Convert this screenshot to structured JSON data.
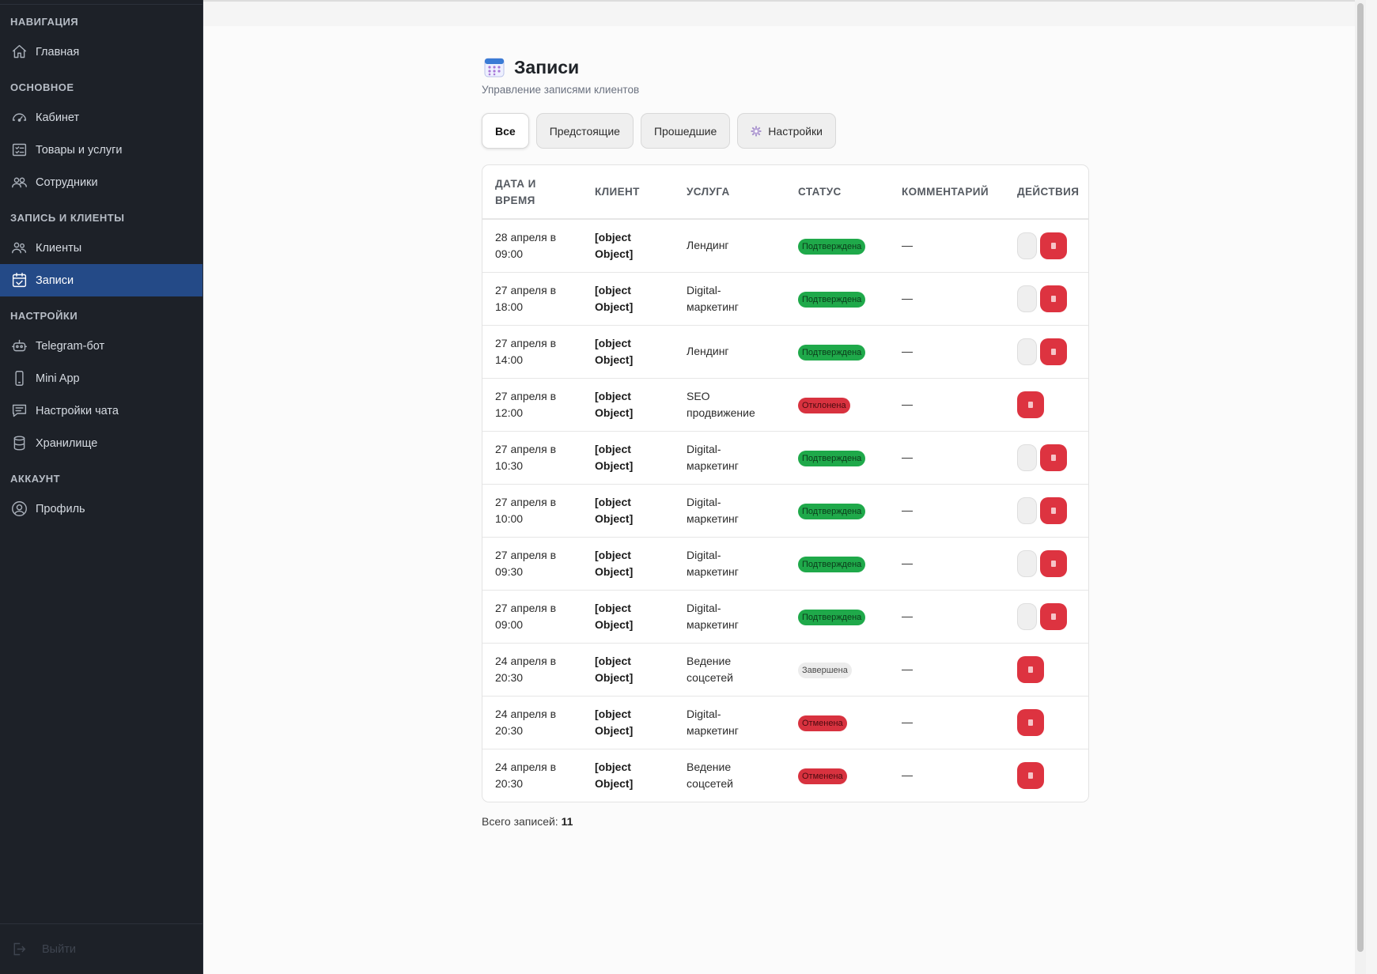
{
  "sidebar": {
    "sections": [
      {
        "title": "НАВИГАЦИЯ",
        "items": [
          {
            "label": "Главная",
            "icon": "home-icon"
          }
        ]
      },
      {
        "title": "ОСНОВНОЕ",
        "items": [
          {
            "label": "Кабинет",
            "icon": "dashboard-icon"
          },
          {
            "label": "Товары и услуги",
            "icon": "list-icon"
          },
          {
            "label": "Сотрудники",
            "icon": "employees-icon"
          }
        ]
      },
      {
        "title": "ЗАПИСЬ И КЛИЕНТЫ",
        "items": [
          {
            "label": "Клиенты",
            "icon": "clients-icon"
          },
          {
            "label": "Записи",
            "icon": "calendar-check-icon",
            "active": true
          }
        ]
      },
      {
        "title": "НАСТРОЙКИ",
        "items": [
          {
            "label": "Telegram-бот",
            "icon": "robot-icon"
          },
          {
            "label": "Mini App",
            "icon": "phone-icon"
          },
          {
            "label": "Настройки чата",
            "icon": "chat-icon"
          },
          {
            "label": "Хранилище",
            "icon": "database-icon"
          }
        ]
      },
      {
        "title": "АККАУНТ",
        "items": [
          {
            "label": "Профиль",
            "icon": "profile-icon"
          }
        ]
      }
    ],
    "logout_label": "Выйти"
  },
  "page": {
    "title": "Записи",
    "subtitle": "Управление записями клиентов"
  },
  "tabs": [
    {
      "label": "Все",
      "active": true
    },
    {
      "label": "Предстоящие"
    },
    {
      "label": "Прошедшие"
    },
    {
      "label": "Настройки",
      "icon": "gear-icon"
    }
  ],
  "table": {
    "headers": {
      "datetime": "ДАТА И ВРЕМЯ",
      "client": "КЛИЕНТ",
      "service": "УСЛУГА",
      "status": "СТАТУС",
      "comment": "КОММЕНТАРИЙ",
      "actions": "ДЕЙСТВИЯ"
    },
    "rows": [
      {
        "date": "28 апреля в",
        "time": "09:00",
        "client1": "[object",
        "client2": "Object]",
        "service1": "Лендинг",
        "service2": "",
        "status": "Подтверждена",
        "status_type": "confirmed",
        "comment": "—",
        "has_edit": true
      },
      {
        "date": "27 апреля в",
        "time": "18:00",
        "client1": "[object",
        "client2": "Object]",
        "service1": "Digital-",
        "service2": "маркетинг",
        "status": "Подтверждена",
        "status_type": "confirmed",
        "comment": "—",
        "has_edit": true
      },
      {
        "date": "27 апреля в",
        "time": "14:00",
        "client1": "[object",
        "client2": "Object]",
        "service1": "Лендинг",
        "service2": "",
        "status": "Подтверждена",
        "status_type": "confirmed",
        "comment": "—",
        "has_edit": true
      },
      {
        "date": "27 апреля в",
        "time": "12:00",
        "client1": "[object",
        "client2": "Object]",
        "service1": "SEO",
        "service2": "продвижение",
        "status": "Отклонена",
        "status_type": "rejected",
        "comment": "—",
        "has_edit": false
      },
      {
        "date": "27 апреля в",
        "time": "10:30",
        "client1": "[object",
        "client2": "Object]",
        "service1": "Digital-",
        "service2": "маркетинг",
        "status": "Подтверждена",
        "status_type": "confirmed",
        "comment": "—",
        "has_edit": true
      },
      {
        "date": "27 апреля в",
        "time": "10:00",
        "client1": "[object",
        "client2": "Object]",
        "service1": "Digital-",
        "service2": "маркетинг",
        "status": "Подтверждена",
        "status_type": "confirmed",
        "comment": "—",
        "has_edit": true
      },
      {
        "date": "27 апреля в",
        "time": "09:30",
        "client1": "[object",
        "client2": "Object]",
        "service1": "Digital-",
        "service2": "маркетинг",
        "status": "Подтверждена",
        "status_type": "confirmed",
        "comment": "—",
        "has_edit": true
      },
      {
        "date": "27 апреля в",
        "time": "09:00",
        "client1": "[object",
        "client2": "Object]",
        "service1": "Digital-",
        "service2": "маркетинг",
        "status": "Подтверждена",
        "status_type": "confirmed",
        "comment": "—",
        "has_edit": true
      },
      {
        "date": "24 апреля в",
        "time": "20:30",
        "client1": "[object",
        "client2": "Object]",
        "service1": "Ведение",
        "service2": "соцсетей",
        "status": "Завершена",
        "status_type": "done",
        "comment": "—",
        "has_edit": false
      },
      {
        "date": "24 апреля в",
        "time": "20:30",
        "client1": "[object",
        "client2": "Object]",
        "service1": "Digital-",
        "service2": "маркетинг",
        "status": "Отменена",
        "status_type": "rejected",
        "comment": "—",
        "has_edit": false
      },
      {
        "date": "24 апреля в",
        "time": "20:30",
        "client1": "[object",
        "client2": "Object]",
        "service1": "Ведение",
        "service2": "соцсетей",
        "status": "Отменена",
        "status_type": "rejected",
        "comment": "—",
        "has_edit": false
      }
    ]
  },
  "footer": {
    "label": "Всего записей:",
    "count": "11"
  },
  "colors": {
    "sidebar_bg": "#1d2128",
    "active_item": "#244a87",
    "confirmed": "#1fa94a",
    "rejected": "#d8323f",
    "delete_button": "#dd3340"
  }
}
